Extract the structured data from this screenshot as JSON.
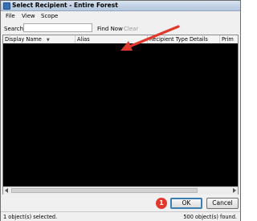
{
  "window": {
    "title": "Select Recipient - Entire Forest"
  },
  "menu": {
    "items": [
      "File",
      "View",
      "Scope"
    ]
  },
  "search": {
    "label": "Search:",
    "value": "",
    "find_now": "Find Now",
    "clear": "Clear"
  },
  "list": {
    "columns": [
      "Display Name",
      "Alias",
      "Recipient Type Details",
      "Prim"
    ],
    "sorted_column": "Display Name",
    "sort_direction": "descending"
  },
  "buttons": {
    "ok": "OK",
    "cancel": "Cancel"
  },
  "annotation": {
    "badge": "1",
    "arrow_color": "#e03a2f"
  },
  "status": {
    "selected": "1 object(s) selected.",
    "found": "500 object(s) found."
  },
  "colors": {
    "ok_border": "#3c7fb1",
    "list_background": "#000000",
    "title_bar": "#c3d3e6"
  }
}
